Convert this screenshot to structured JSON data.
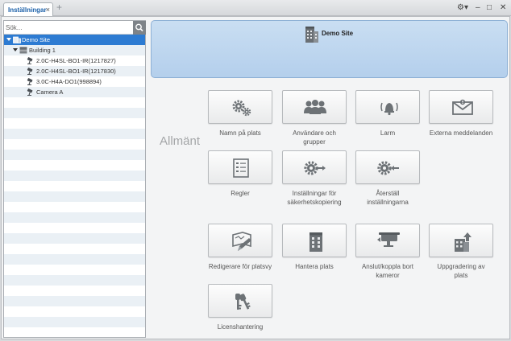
{
  "window": {
    "tab_title": "Inställningar",
    "tab_close": "×",
    "add_tab": "+",
    "gear_menu": "⚙▾",
    "minimize": "‒",
    "maximize": "□",
    "close": "✕"
  },
  "search": {
    "placeholder": "Sök..."
  },
  "tree": [
    {
      "label": "Demo Site",
      "icon": "site-icon",
      "expanded": true,
      "selected": true
    },
    {
      "label": "Building 1",
      "icon": "building-icon",
      "expanded": true,
      "selected": false
    },
    {
      "label": "2.0C-H4SL-BO1-IR(1217827)",
      "icon": "camera-icon",
      "selected": false
    },
    {
      "label": "2.0C-H4SL-BO1-IR(1217830)",
      "icon": "camera-icon",
      "selected": false
    },
    {
      "label": "3.0C-H4A-DO1(998894)",
      "icon": "camera-icon",
      "selected": false
    },
    {
      "label": "Camera A",
      "icon": "camera-icon",
      "selected": false
    }
  ],
  "banner": {
    "title": "Demo Site",
    "icon": "site-building-icon"
  },
  "section": {
    "title": "Allmänt"
  },
  "tiles": {
    "site_name": {
      "label_1": "Namn på plats",
      "label_2": "",
      "icon": "gears-icon"
    },
    "users": {
      "label_1": "Användare och",
      "label_2": "grupper",
      "icon": "users-icon"
    },
    "alarms": {
      "label_1": "Larm",
      "label_2": "",
      "icon": "alarm-bell-icon"
    },
    "external_messages": {
      "label_1": "Externa meddelanden",
      "label_2": "",
      "icon": "envelope-icon"
    },
    "rules": {
      "label_1": "Regler",
      "label_2": "",
      "icon": "checklist-icon"
    },
    "backup_settings": {
      "label_1": "Inställningar för",
      "label_2": "säkerhetskopiering",
      "icon": "gear-export-icon"
    },
    "restore_settings": {
      "label_1": "Återställ",
      "label_2": "inställningarna",
      "icon": "gear-import-icon"
    },
    "site_view_editor": {
      "label_1": "Redigerare för platsvy",
      "label_2": "",
      "icon": "map-edit-icon"
    },
    "manage_site": {
      "label_1": "Hantera plats",
      "label_2": "",
      "icon": "building-icon"
    },
    "connect_cameras": {
      "label_1": "Anslut/koppla bort",
      "label_2": "kameror",
      "icon": "camera-connect-icon"
    },
    "upgrade_site": {
      "label_1": "Uppgradering av",
      "label_2": "plats",
      "icon": "upgrade-building-icon"
    },
    "licensing": {
      "label_1": "Licenshantering",
      "label_2": "",
      "icon": "keys-icon"
    }
  },
  "colors": {
    "accent": "#2d7bd2",
    "banner": "#c0d7ef",
    "icon_gray": "#6d7276",
    "tab_text": "#1a5fa8"
  }
}
